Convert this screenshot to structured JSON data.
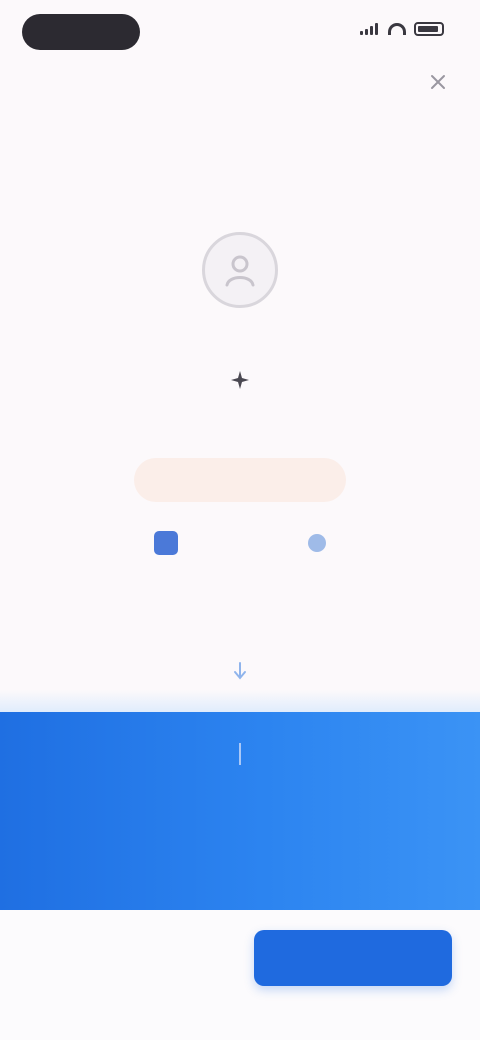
{
  "status_bar": {
    "time": "",
    "icons": [
      "signal-icon",
      "wifi-icon",
      "battery-icon"
    ]
  },
  "header": {
    "close_icon": "close-icon",
    "title": "",
    "subtitle": ""
  },
  "profile": {
    "avatar_icon": "user-icon"
  },
  "feature": {
    "icon": "sparkle-icon",
    "headline": "",
    "promo_chip": "",
    "rating_text": ""
  },
  "plans": {
    "section_label": "",
    "arrow_icon": "arrow-down-icon",
    "tabs": [
      {
        "label": ""
      },
      {
        "label": ""
      }
    ],
    "footer_note": ""
  },
  "actions": {
    "secondary_label": "",
    "primary_label": ""
  },
  "colors": {
    "accent": "#1f6adf",
    "panel": "#2c84f0",
    "promo_bg": "#fbeee9",
    "promo_text": "#d88b73"
  }
}
